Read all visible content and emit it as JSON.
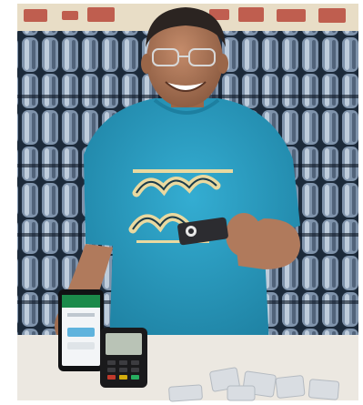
{
  "photo": {
    "subject": "man-holding-card-reader",
    "scene": "shop-counter-with-water-bottle-packs",
    "colors": {
      "frame": "#ffffff",
      "shelf_back": "#1c2a3a",
      "bottle_light": "#c9d6e4",
      "bottle_mid": "#7f93ab",
      "bottle_dark": "#3e4f66",
      "label_red": "#b8483b",
      "label_cream": "#e8ddc6",
      "shirt": "#2aa1c6",
      "shirt_shadow": "#1d7fa0",
      "skin": "#b07a5c",
      "skin_shadow": "#8a5a40",
      "hair": "#2b2421",
      "counter": "#ece8e1",
      "phone_screen": "#f3f5f7",
      "phone_header": "#1b8a4a",
      "terminal_screen": "#b9c3b6",
      "terminal_body": "#1a1a1c",
      "card": "#2c2c30",
      "wave": "#e9d9a0",
      "wave_outline": "#1b3b4a"
    }
  }
}
